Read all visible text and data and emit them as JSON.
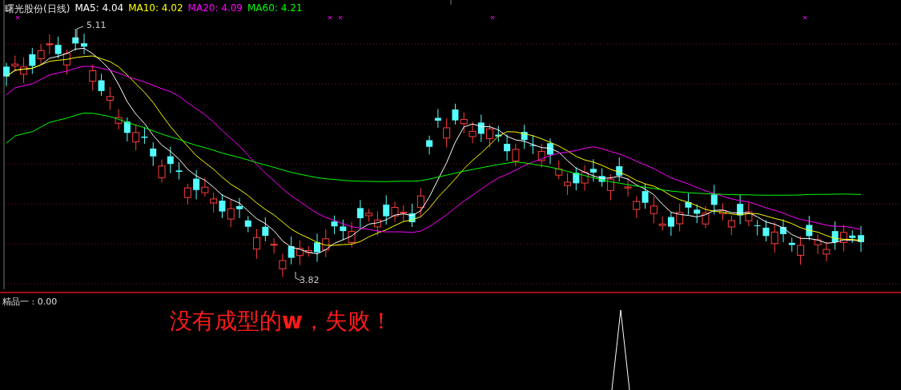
{
  "chart": {
    "title": "曙光股份(日线)",
    "indicators": [
      {
        "label": "MA5: 4.04",
        "color": "#ffffff"
      },
      {
        "label": "MA10: 4.02",
        "color": "#ffff00"
      },
      {
        "label": "MA20: 4.09",
        "color": "#ff00ff"
      },
      {
        "label": "MA60: 4.21",
        "color": "#00ff00"
      }
    ],
    "high_label": "5.11",
    "low_label": "3.82"
  },
  "sub_chart": {
    "label": "精品一 : 0.00",
    "message": "没有成型的**w**，失败！"
  }
}
